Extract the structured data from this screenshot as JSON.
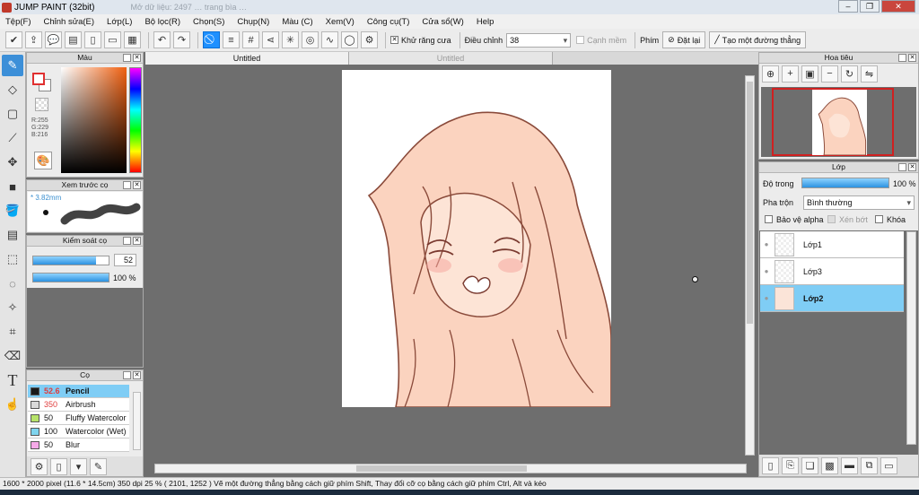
{
  "window": {
    "title": "JUMP PAINT (32bit)",
    "ghost_text": "Mở dữ liệu: 2497 … trang bìa …",
    "min": "–",
    "max": "❐",
    "close": "✕"
  },
  "menu": [
    "Tệp(F)",
    "Chỉnh sửa(E)",
    "Lớp(L)",
    "Bộ lọc(R)",
    "Chọn(S)",
    "Chụp(N)",
    "Màu (C)",
    "Xem(V)",
    "Công cụ(T)",
    "Cửa sổ(W)",
    "Help"
  ],
  "toolbar": {
    "antialias_label": "Khử răng cưa",
    "adjust_label": "Điều chỉnh",
    "adjust_value": "38",
    "smooth_label": "Cạnh mềm",
    "key_label": "Phím",
    "reset_label": "Đặt lại",
    "straight_line_label": "Tạo một đường thẳng"
  },
  "color_panel": {
    "title": "Màu",
    "r": "R:255",
    "g": "G:229",
    "b": "B:216",
    "fg": "#f9e5d8"
  },
  "brush_preview": {
    "title": "Xem trước cọ",
    "size": "3.82mm"
  },
  "brush_control": {
    "title": "Kiểm soát cọ",
    "size_value": "52",
    "size_fill": 0.83,
    "opacity_value": "100 %",
    "opacity_fill": 1.0
  },
  "brushes": {
    "title": "Cọ",
    "items": [
      {
        "size": "52.6",
        "name": "Pencil",
        "color": "#1a1a1a",
        "selected": true
      },
      {
        "size": "350",
        "name": "Airbrush",
        "color": "#d9d9d9",
        "selected": false
      },
      {
        "size": "50",
        "name": "Fluffy Watercolor",
        "color": "#b7e36a",
        "selected": false
      },
      {
        "size": "100",
        "name": "Watercolor (Wet)",
        "color": "#7fd4ee",
        "selected": false
      },
      {
        "size": "50",
        "name": "Blur",
        "color": "#f6a9e8",
        "selected": false
      }
    ]
  },
  "tabs": [
    "Untitled",
    "Untitled"
  ],
  "navigator": {
    "title": "Hoa tiêu"
  },
  "layer_panel": {
    "title": "Lớp",
    "opacity_label": "Độ trong",
    "opacity_value": "100 %",
    "opacity_fill": 1.0,
    "blend_label": "Pha trộn",
    "blend_value": "Bình thường",
    "alpha_label": "Bảo vệ alpha",
    "clip_label": "Xén bớt",
    "lock_label": "Khóa",
    "layers": [
      {
        "name": "Lớp1",
        "selected": false
      },
      {
        "name": "Lớp3",
        "selected": false
      },
      {
        "name": "Lớp2",
        "selected": true
      }
    ]
  },
  "status": {
    "text": "1600 * 2000 pixel   (11.6 * 14.5cm)   350 dpi   25 %   ( 2101, 1252 )   Vẽ một đường thẳng bằng cách giữ phím Shift, Thay đổi cỡ cọ bằng cách giữ phím Ctrl, Alt và kéo"
  }
}
